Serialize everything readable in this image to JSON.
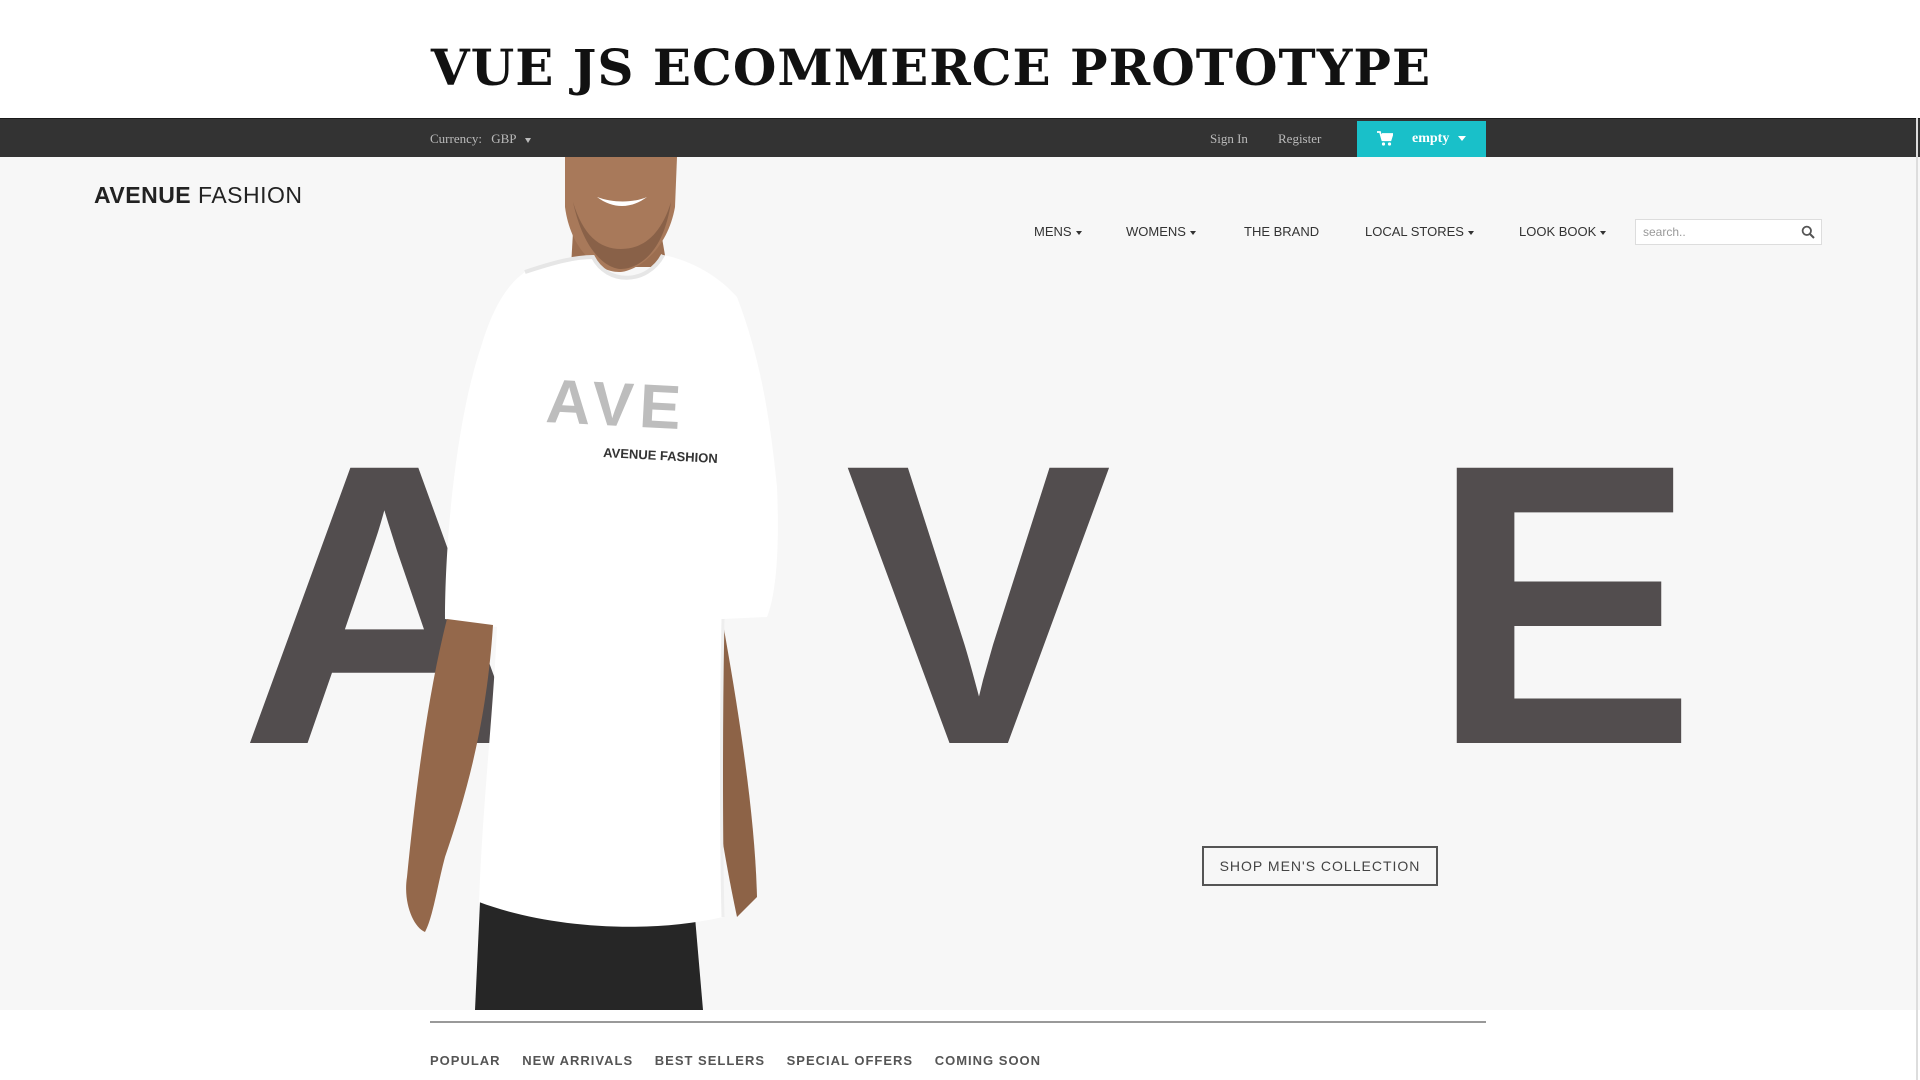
{
  "banner": {
    "title": "VUE JS ECOMMERCE PROTOTYPE"
  },
  "topbar": {
    "currency_label": "Currency:",
    "currency_value": "GBP",
    "sign_in": "Sign In",
    "register": "Register",
    "cart_label": "empty",
    "cart_color": "#19c0c9"
  },
  "header": {
    "logo_bold": "AVENUE",
    "logo_light": "FASHION"
  },
  "nav": {
    "items": [
      {
        "label": "MENS",
        "dropdown": true
      },
      {
        "label": "WOMENS",
        "dropdown": true
      },
      {
        "label": "THE BRAND",
        "dropdown": false
      },
      {
        "label": "LOCAL STORES",
        "dropdown": true
      },
      {
        "label": "LOOK BOOK",
        "dropdown": true
      }
    ]
  },
  "search": {
    "placeholder": "search.."
  },
  "hero": {
    "letters": [
      "A",
      "V",
      "E"
    ],
    "letter_color": "#524d4e",
    "shirt_print_letters": "AVE",
    "shirt_print_text": "AVENUE FASHION",
    "cta": "SHOP MEN'S COLLECTION"
  },
  "tabs": [
    "POPULAR",
    "NEW ARRIVALS",
    "BEST SELLERS",
    "SPECIAL OFFERS",
    "COMING SOON"
  ]
}
